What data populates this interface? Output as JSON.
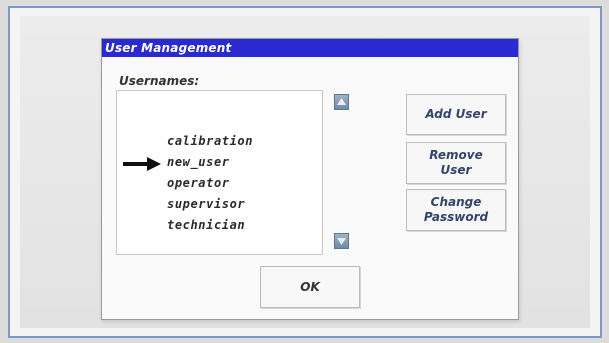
{
  "dialog": {
    "title": "User Management",
    "usernames_label": "Usernames:",
    "users": [
      "calibration",
      "new_user",
      "operator",
      "supervisor",
      "technician"
    ],
    "selected_user": "new_user",
    "buttons": {
      "add_user": "Add User",
      "remove_user": "Remove User",
      "change_password": "Change Password",
      "ok": "OK"
    }
  },
  "colors": {
    "titlebar": "#2a2ad0",
    "button_text": "#34456a",
    "scroll_button": "#7f98b4"
  },
  "icons": {
    "selection": "right-arrow-icon",
    "scroll_up": "triangle-up-icon",
    "scroll_down": "triangle-down-icon"
  }
}
